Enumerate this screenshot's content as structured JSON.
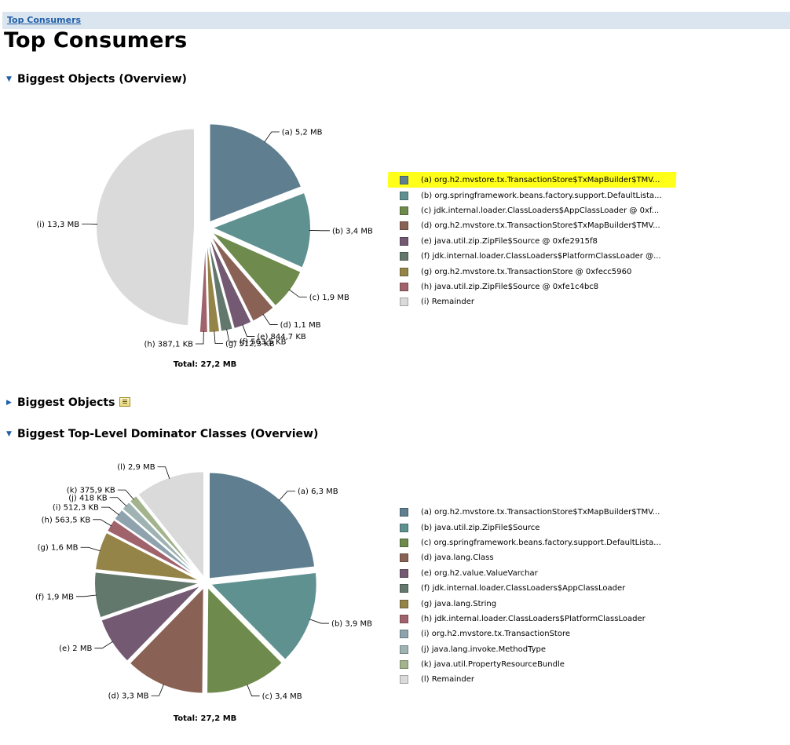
{
  "breadcrumb": {
    "link": "Top Consumers"
  },
  "page_title": "Top Consumers",
  "sections": {
    "biggest_overview": "Biggest Objects (Overview)",
    "biggest_objects": "Biggest Objects",
    "dominator_overview": "Biggest Top-Level Dominator Classes (Overview)"
  },
  "highlight_color": "#ffff1a",
  "chart_data": [
    {
      "type": "pie",
      "title": "Biggest Objects (Overview)",
      "total_label": "Total: 27,2 MB",
      "unit": "MB",
      "slices": [
        {
          "label": "(a) 5,2 MB",
          "value": 5.2,
          "color": "#5f7e8f",
          "legend": "(a)  org.h2.mvstore.tx.TransactionStore$TxMapBuilder$TMV...",
          "highlighted": true
        },
        {
          "label": "(b) 3,4 MB",
          "value": 3.4,
          "color": "#5f9191",
          "legend": "(b)  org.springframework.beans.factory.support.DefaultLista..."
        },
        {
          "label": "(c) 1,9 MB",
          "value": 1.9,
          "color": "#6e8a4c",
          "legend": "(c)  jdk.internal.loader.ClassLoaders$AppClassLoader @ 0xf..."
        },
        {
          "label": "(d) 1,1 MB",
          "value": 1.1,
          "color": "#8a6255",
          "legend": "(d)  org.h2.mvstore.tx.TransactionStore$TxMapBuilder$TMV..."
        },
        {
          "label": "(e) 844,7 KB",
          "value": 0.825,
          "color": "#735a72",
          "legend": "(e)  java.util.zip.ZipFile$Source @ 0xfe2915f8"
        },
        {
          "label": "(f) 563,5 KB",
          "value": 0.55,
          "color": "#63786d",
          "legend": "(f)  jdk.internal.loader.ClassLoaders$PlatformClassLoader @..."
        },
        {
          "label": "(g) 512,3 KB",
          "value": 0.5,
          "color": "#958448",
          "legend": "(g)  org.h2.mvstore.tx.TransactionStore @ 0xfecc5960"
        },
        {
          "label": "(h) 387,1 KB",
          "value": 0.378,
          "color": "#a0636c",
          "legend": "(h)  java.util.zip.ZipFile$Source @ 0xfe1c4bc8"
        },
        {
          "label": "(i) 13,3 MB",
          "value": 13.3,
          "color": "#dadada",
          "legend": "(i)  Remainder"
        }
      ]
    },
    {
      "type": "pie",
      "title": "Biggest Top-Level Dominator Classes (Overview)",
      "total_label": "Total: 27,2 MB",
      "unit": "MB",
      "slices": [
        {
          "label": "(a) 6,3 MB",
          "value": 6.3,
          "color": "#5f7e8f",
          "legend": "(a)  org.h2.mvstore.tx.TransactionStore$TxMapBuilder$TMV..."
        },
        {
          "label": "(b) 3,9 MB",
          "value": 3.9,
          "color": "#5f9191",
          "legend": "(b)  java.util.zip.ZipFile$Source"
        },
        {
          "label": "(c) 3,4 MB",
          "value": 3.4,
          "color": "#6e8a4c",
          "legend": "(c)  org.springframework.beans.factory.support.DefaultLista..."
        },
        {
          "label": "(d) 3,3 MB",
          "value": 3.3,
          "color": "#8a6255",
          "legend": "(d)  java.lang.Class"
        },
        {
          "label": "(e) 2 MB",
          "value": 2.0,
          "color": "#735a72",
          "legend": "(e)  org.h2.value.ValueVarchar"
        },
        {
          "label": "(f) 1,9 MB",
          "value": 1.9,
          "color": "#63786d",
          "legend": "(f)  jdk.internal.loader.ClassLoaders$AppClassLoader"
        },
        {
          "label": "(g) 1,6 MB",
          "value": 1.6,
          "color": "#958448",
          "legend": "(g)  java.lang.String"
        },
        {
          "label": "(h) 563,5 KB",
          "value": 0.55,
          "color": "#a0636c",
          "legend": "(h)  jdk.internal.loader.ClassLoaders$PlatformClassLoader"
        },
        {
          "label": "(i) 512,3 KB",
          "value": 0.5,
          "color": "#8fa3ae",
          "legend": "(i)  org.h2.mvstore.tx.TransactionStore"
        },
        {
          "label": "(j) 418 KB",
          "value": 0.408,
          "color": "#9fb4b2",
          "legend": "(j)  java.lang.invoke.MethodType"
        },
        {
          "label": "(k) 375,9 KB",
          "value": 0.367,
          "color": "#a3b48c",
          "legend": "(k)  java.util.PropertyResourceBundle"
        },
        {
          "label": "(l) 2,9 MB",
          "value": 2.9,
          "color": "#dadada",
          "legend": "(l)  Remainder"
        }
      ]
    }
  ]
}
